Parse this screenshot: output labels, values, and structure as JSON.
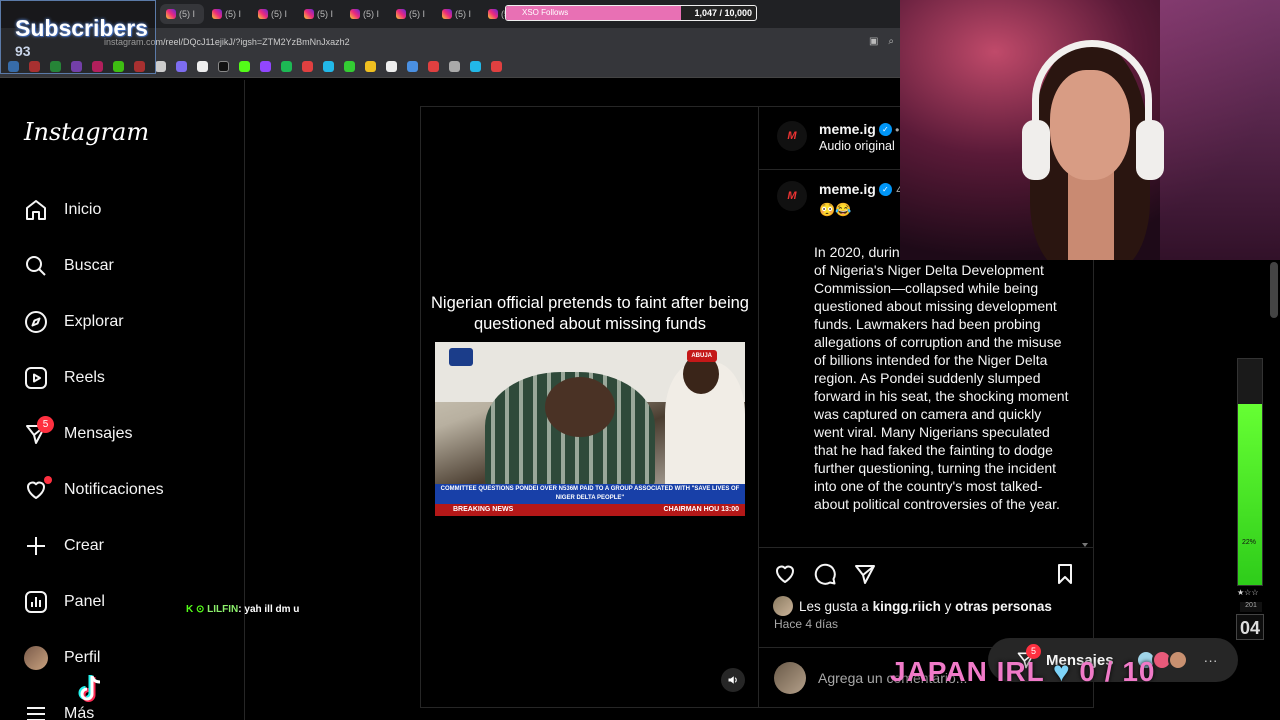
{
  "overlay": {
    "subscribers_title": "Subscribers",
    "subscribers_count": "93",
    "follows_goal_label": "XSO Follows",
    "follows_goal_count": "1,047 / 10,000",
    "follows_goal_progress": 0.7,
    "meter_percent": "22%",
    "meter_level": 0.8,
    "stars": "★☆☆",
    "meter_code": "201",
    "counter": "04",
    "goal_text_left": "JAPAN IRL",
    "goal_text_right": "0 / 10"
  },
  "browser": {
    "tab_label": "(5) I",
    "url": "instagram.com/reel/DQcJ11ejikJ/?igsh=ZTM2YzBmNnJxazh2",
    "accent_colors": [
      "#e870b4",
      "#7dd3f8",
      "#8cf06b"
    ]
  },
  "chat": {
    "user": "LILFIN",
    "message": ": yah ill dm u"
  },
  "sidebar": {
    "logo": "Instagram",
    "items": [
      {
        "label": "Inicio",
        "icon": "home-icon"
      },
      {
        "label": "Buscar",
        "icon": "search-icon"
      },
      {
        "label": "Explorar",
        "icon": "compass-icon"
      },
      {
        "label": "Reels",
        "icon": "reels-icon"
      },
      {
        "label": "Mensajes",
        "icon": "messenger-icon",
        "badge": "5"
      },
      {
        "label": "Notificaciones",
        "icon": "heart-icon"
      },
      {
        "label": "Crear",
        "icon": "plus-icon"
      },
      {
        "label": "Panel",
        "icon": "chart-icon"
      },
      {
        "label": "Perfil",
        "icon": "avatar"
      },
      {
        "label": "Más",
        "icon": "menu-icon"
      }
    ]
  },
  "reel": {
    "caption": "Nigerian official pretends to faint after being questioned about missing funds",
    "ticker": "COMMITTEE QUESTIONS PONDEI OVER N536M PAID TO A GROUP ASSOCIATED WITH \"SAVE LIVES OF NIGER DELTA PEOPLE\"",
    "breaking": "BREAKING NEWS",
    "breaking_right": "CHAIRMAN HOU     13:00",
    "location_tag": "ABUJA"
  },
  "post": {
    "author": "meme.ig",
    "audio": "Audio original",
    "logo_text": "M",
    "emojis": "😳😂",
    "time_short": "4",
    "body": "In 2020, during Daniel Pondei—the head of Nigeria's Niger Delta Development Commission—collapsed while being questioned about missing development funds. Lawmakers had been probing allegations of corruption and the misuse of billions intended for the Niger Delta region. As Pondei suddenly slumped forward in his seat, the shocking moment was captured on camera and quickly went viral. Many Nigerians speculated that he had faked the fainting to dodge further questioning, turning the incident into one of the country's most talked-about political controversies of the year.",
    "likes_prefix": "Les gusta a ",
    "likes_user": "kingg.riich",
    "likes_mid": " y ",
    "likes_rest": "otras personas",
    "ago": "Hace 4 días",
    "comment_placeholder": "Agrega un comentario..."
  },
  "messages_pill": {
    "label": "Mensajes",
    "badge": "5",
    "more": "···"
  }
}
